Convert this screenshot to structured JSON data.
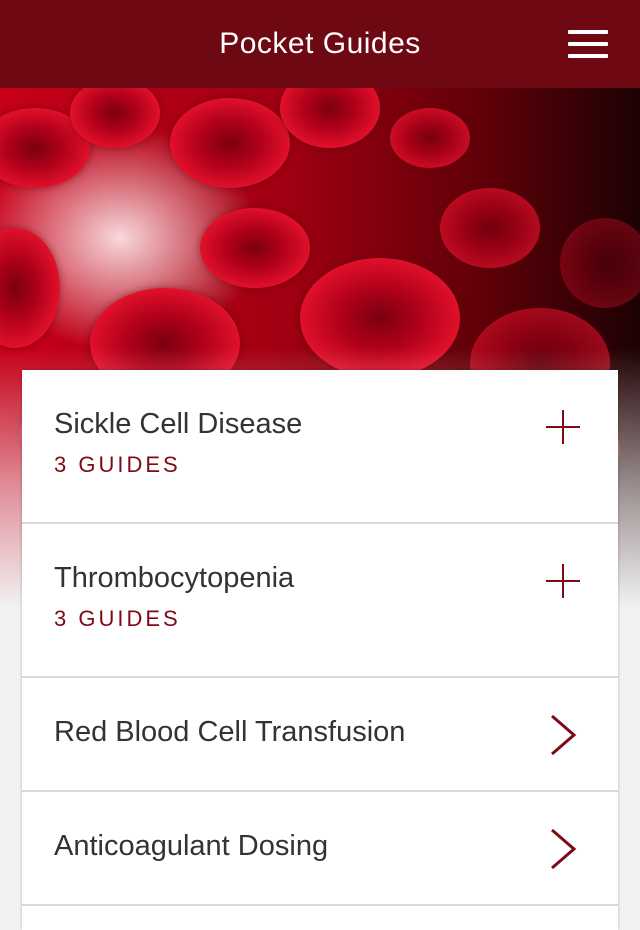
{
  "header": {
    "title": "Pocket Guides",
    "menu_icon": "hamburger-menu-icon"
  },
  "hero": {
    "image": "red-blood-cells-illustration"
  },
  "colors": {
    "header_bg": "#6e0812",
    "accent": "#7d0a16",
    "text": "#333333",
    "divider": "#d9d9d9"
  },
  "guides": [
    {
      "title": "Sickle Cell Disease",
      "subtitle": "3 GUIDES",
      "icon": "plus-icon"
    },
    {
      "title": "Thrombocytopenia",
      "subtitle": "3 GUIDES",
      "icon": "plus-icon"
    },
    {
      "title": "Red Blood Cell Transfusion",
      "icon": "chevron-right-icon"
    },
    {
      "title": "Anticoagulant Dosing",
      "icon": "chevron-right-icon"
    }
  ]
}
